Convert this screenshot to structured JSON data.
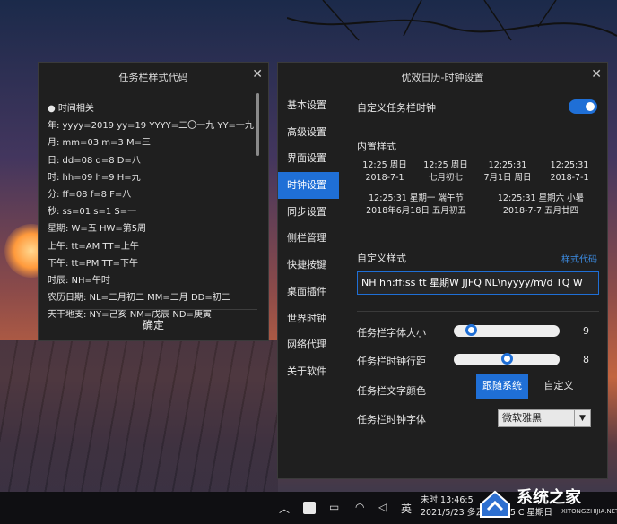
{
  "code_window": {
    "title": "任务栏样式代码",
    "ok_label": "确定",
    "lines": [
      "● 时间相关",
      "年: yyyy=2019 yy=19 YYYY=二〇一九 YY=一九",
      "月: mm=03 m=3 M=三",
      "日: dd=08 d=8 D=八",
      "时: hh=09 h=9 H=九",
      "分: ff=08 f=8 F=八",
      "秒: ss=01 s=1 S=一",
      "星期: W=五 HW=第5周",
      "上午: tt=AM TT=上午",
      "下午: tt=PM TT=下午",
      "时辰: NH=午时",
      "农历日期: NL=二月初二 MM=二月 DD=初二",
      "天干地支: NY=己亥 NM=戊辰 ND=庚寅"
    ]
  },
  "settings_window": {
    "title": "优效日历-时钟设置",
    "nav": [
      "基本设置",
      "高级设置",
      "界面设置",
      "时钟设置",
      "同步设置",
      "侧栏管理",
      "快捷按键",
      "桌面插件",
      "世界时钟",
      "网络代理",
      "关于软件"
    ],
    "active_nav": "时钟设置",
    "custom_clock_label": "自定义任务栏时钟",
    "custom_clock_enabled": true,
    "builtin_label": "内置样式",
    "samples": [
      {
        "l1": "12:25 周日",
        "l2": "2018-7-1"
      },
      {
        "l1": "12:25 周日",
        "l2": "七月初七"
      },
      {
        "l1": "12:25:31",
        "l2": "7月1日 周日"
      },
      {
        "l1": "12:25:31",
        "l2": "2018-7-1"
      },
      {
        "l1": "12:25:31 星期一 端午节",
        "l2": "2018年6月18日 五月初五"
      },
      {
        "l1": "12:25:31 星期六 小暑",
        "l2": "2018-7-7 五月廿四"
      }
    ],
    "custom_style_label": "自定义样式",
    "style_code_link": "样式代码",
    "custom_style_value": "NH hh:ff:ss tt 星期W JJFQ NL\\nyyyy/m/d TQ W",
    "font_size_label": "任务栏字体大小",
    "font_size_value": "9",
    "font_size_fraction": 0.12,
    "line_spacing_label": "任务栏时钟行距",
    "line_spacing_value": "8",
    "line_spacing_fraction": 0.5,
    "text_color_label": "任务栏文字颜色",
    "follow_system_label": "跟随系统",
    "custom_label": "自定义",
    "font_label": "任务栏时钟字体",
    "font_value": "微软雅黑"
  },
  "taskbar": {
    "clock_line1": "未时 13:46:5",
    "clock_line2": "2021/5/23 多云 27~35 C 星期日",
    "ime_label": "英"
  },
  "watermark": {
    "text": "系统之家",
    "url": "XITONGZHIJIA.NET"
  }
}
